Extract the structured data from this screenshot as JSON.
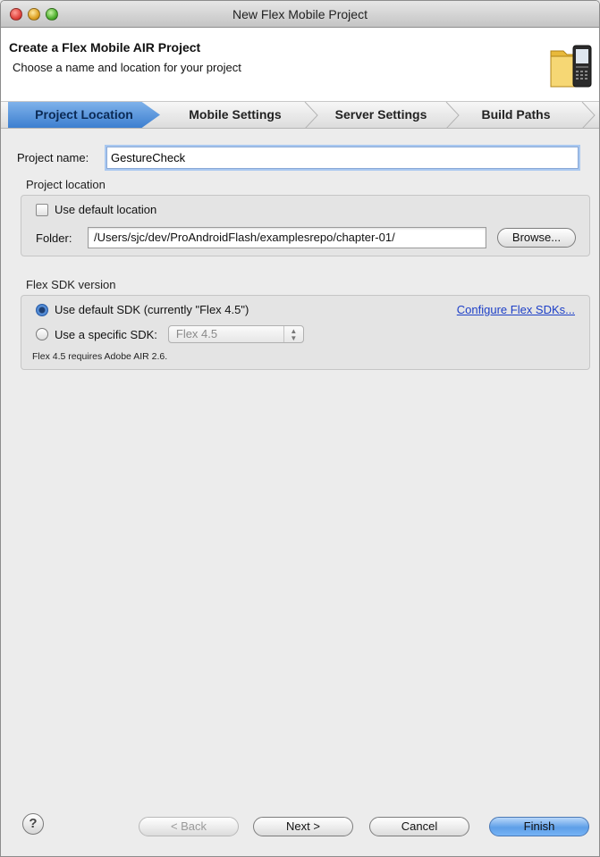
{
  "window": {
    "title": "New Flex Mobile Project"
  },
  "header": {
    "title": "Create a Flex Mobile AIR Project",
    "subtitle": "Choose a name and location for your project"
  },
  "tabs": [
    {
      "label": "Project Location",
      "active": true
    },
    {
      "label": "Mobile Settings",
      "active": false
    },
    {
      "label": "Server Settings",
      "active": false
    },
    {
      "label": "Build Paths",
      "active": false
    }
  ],
  "project": {
    "name_label": "Project name:",
    "name_value": "GestureCheck"
  },
  "location": {
    "group_label": "Project location",
    "use_default_label": "Use default location",
    "use_default_checked": false,
    "folder_label": "Folder:",
    "folder_value": "/Users/sjc/dev/ProAndroidFlash/examplesrepo/chapter-01/",
    "browse_label": "Browse..."
  },
  "sdk": {
    "group_label": "Flex SDK version",
    "default_option_label": "Use default SDK (currently \"Flex 4.5\")",
    "specific_option_label": "Use a specific SDK:",
    "selected_option": "default",
    "specific_sdk_value": "Flex 4.5",
    "configure_link": "Configure Flex SDKs...",
    "note": "Flex 4.5 requires Adobe AIR 2.6."
  },
  "footer": {
    "help_label": "?",
    "back_label": "< Back",
    "next_label": "Next >",
    "cancel_label": "Cancel",
    "finish_label": "Finish"
  },
  "colors": {
    "active_tab": "#5b97e0",
    "link": "#1d3fc7",
    "default_button": "#6aa9ef"
  }
}
